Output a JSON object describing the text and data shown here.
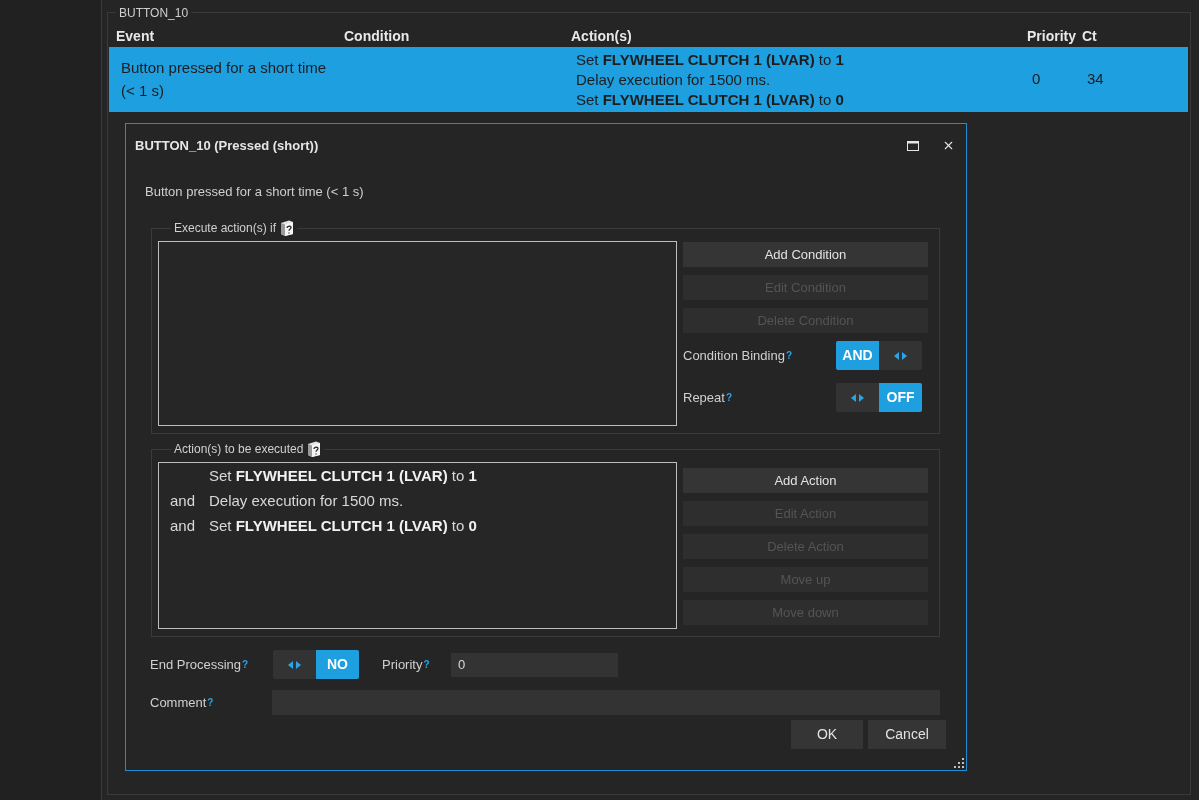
{
  "group": {
    "title": "BUTTON_10"
  },
  "table": {
    "columns": [
      "Event",
      "Condition",
      "Action(s)",
      "Priority",
      "Ct"
    ],
    "rows": [
      {
        "selected": true,
        "event": "Button pressed for a short time (< 1 s)",
        "actions": [
          "Set **FLYWHEEL CLUTCH 1 (LVAR)** to **1**",
          "Delay execution for 1500 ms.",
          "Set **FLYWHEEL CLUTCH 1 (LVAR)** to **0**"
        ],
        "priority": "0",
        "count": "34"
      }
    ]
  },
  "dialog": {
    "title": "BUTTON_10 (Pressed (short))",
    "description": "Button pressed for a short time (< 1 s)",
    "conditions": {
      "title": "Execute action(s) if",
      "buttons": [
        {
          "label": "Add Condition",
          "disabled": false
        },
        {
          "label": "Edit Condition",
          "disabled": true
        },
        {
          "label": "Delete Condition",
          "disabled": true
        }
      ],
      "settings": [
        {
          "label": "Condition Binding",
          "help": "?",
          "value": "AND",
          "value_left": true
        },
        {
          "label": "Repeat",
          "help": "?",
          "value": "OFF",
          "value_left": false
        }
      ]
    },
    "actions": {
      "title": "Action(s) to be executed",
      "items": [
        {
          "text": "Set **FLYWHEEL CLUTCH 1 (LVAR)** to **1**"
        },
        {
          "connector": "and",
          "text": "Delay execution for 1500 ms."
        },
        {
          "connector": "and",
          "text": "Set **FLYWHEEL CLUTCH 1 (LVAR)** to **0**"
        }
      ],
      "buttons": [
        {
          "label": "Add Action",
          "disabled": false
        },
        {
          "label": "Edit Action",
          "disabled": true
        },
        {
          "label": "Delete Action",
          "disabled": true
        },
        {
          "label": "Move up",
          "disabled": true
        },
        {
          "label": "Move down",
          "disabled": true
        }
      ]
    },
    "end_processing": {
      "label": "End Processing",
      "help": "?",
      "value": "NO",
      "value_left": false
    },
    "priority": {
      "label": "Priority",
      "help": "?",
      "value": "0"
    },
    "comment": {
      "label": "Comment",
      "help": "?"
    },
    "buttons": [
      "OK",
      "Cancel"
    ]
  }
}
